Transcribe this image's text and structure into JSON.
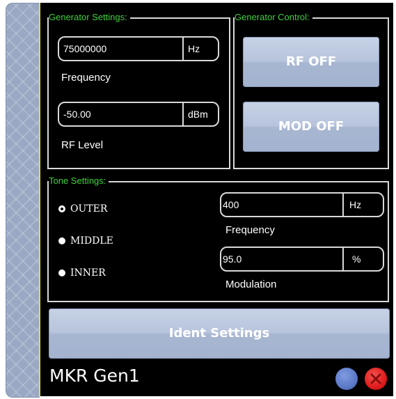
{
  "generator_settings": {
    "title": "Generator Settings:",
    "frequency": {
      "value": "75000000",
      "unit": "Hz",
      "label": "Frequency"
    },
    "rf_level": {
      "value": "-50.00",
      "unit": "dBm",
      "label": "RF Level"
    }
  },
  "generator_control": {
    "title": "Generator Control:",
    "rf_button": "RF OFF",
    "mod_button": "MOD OFF"
  },
  "tone_settings": {
    "title": "Tone Settings:",
    "options": [
      "OUTER",
      "MIDDLE",
      "INNER"
    ],
    "selected": "OUTER",
    "frequency": {
      "value": "400",
      "unit": "Hz",
      "label": "Frequency"
    },
    "modulation": {
      "value": "95.0",
      "unit": "%",
      "label": "Modulation"
    }
  },
  "ident_button": "Ident Settings",
  "footer": {
    "title": "MKR Gen1",
    "blue_button_color": "#5b79c7",
    "close_button_color": "#e01b1b"
  }
}
